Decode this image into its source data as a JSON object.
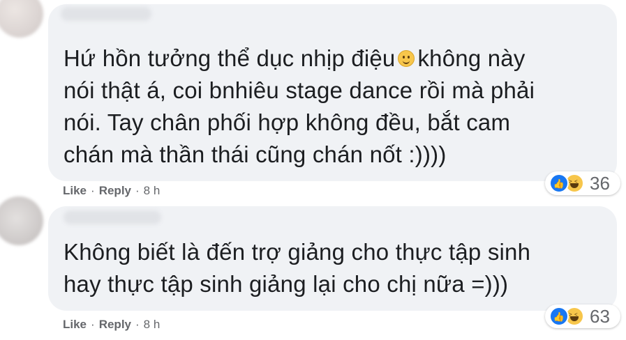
{
  "comments": [
    {
      "text_line1a": "Hứ hồn tưởng thể dục nhịp điệu",
      "text_line1b": "không này",
      "text_rest": "nói thật á, coi bnhiêu stage dance rồi mà phải\nnói. Tay chân phối hợp không đều, bắt cam\nchán mà thần thái cũng chán nốt :))))",
      "inline_emoji": "slightly-smiling-face-icon",
      "actions": {
        "like": "Like",
        "reply": "Reply",
        "time": "8 h"
      },
      "reactions": {
        "icons": [
          "like-icon",
          "haha-icon"
        ],
        "count": "36"
      }
    },
    {
      "text": "Không biết là đến trợ giảng cho thực tập sinh\nhay thực tập sinh giảng lại cho chị nữa =)))",
      "actions": {
        "like": "Like",
        "reply": "Reply",
        "time": "8 h"
      },
      "reactions": {
        "icons": [
          "like-icon",
          "haha-icon"
        ],
        "count": "63"
      }
    }
  ],
  "separator": "·",
  "colors": {
    "bubble_bg": "#f0f2f5",
    "text": "#1c1e21",
    "meta": "#65676b",
    "like_blue": "#1877f2",
    "haha_yellow": "#f7c64b"
  }
}
